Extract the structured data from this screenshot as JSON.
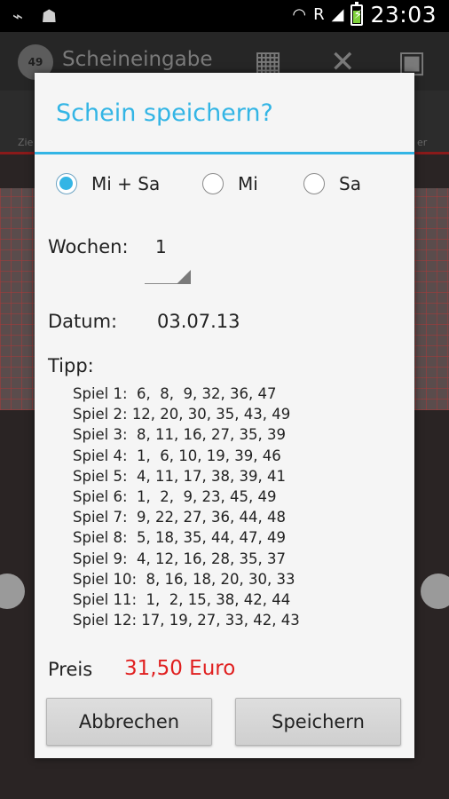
{
  "status_bar": {
    "time": "23:03",
    "roaming_indicator": "R",
    "icons": [
      "usb-icon",
      "android-icon",
      "wifi-icon",
      "signal-icon",
      "battery-charging-icon"
    ]
  },
  "action_bar": {
    "title": "Scheineingabe",
    "logo_text": "49",
    "actions": [
      "calendar-icon",
      "close-icon",
      "save-icon"
    ]
  },
  "background_tabs": {
    "left_label": "Zie",
    "right_label": "er"
  },
  "dialog": {
    "title": "Schein speichern?",
    "draw_options": [
      {
        "label": "Mi + Sa",
        "checked": true
      },
      {
        "label": "Mi",
        "checked": false
      },
      {
        "label": "Sa",
        "checked": false
      }
    ],
    "wochen_label": "Wochen:",
    "wochen_value": "1",
    "datum_label": "Datum:",
    "datum_value": "03.07.13",
    "tipp_label": "Tipp:",
    "tipps": [
      "Spiel 1:  6,  8,  9, 32, 36, 47",
      "Spiel 2: 12, 20, 30, 35, 43, 49",
      "Spiel 3:  8, 11, 16, 27, 35, 39",
      "Spiel 4:  1,  6, 10, 19, 39, 46",
      "Spiel 5:  4, 11, 17, 38, 39, 41",
      "Spiel 6:  1,  2,  9, 23, 45, 49",
      "Spiel 7:  9, 22, 27, 36, 44, 48",
      "Spiel 8:  5, 18, 35, 44, 47, 49",
      "Spiel 9:  4, 12, 16, 28, 35, 37",
      "Spiel 10:  8, 16, 18, 20, 30, 33",
      "Spiel 11:  1,  2, 15, 38, 42, 44",
      "Spiel 12: 17, 19, 27, 33, 42, 43"
    ],
    "preis_label": "Preis",
    "preis_value": "31,50 Euro",
    "cancel_label": "Abbrechen",
    "save_label": "Speichern"
  },
  "colors": {
    "accent": "#33b5e5",
    "price": "#e02020",
    "dialog_bg": "#f5f5f5"
  }
}
